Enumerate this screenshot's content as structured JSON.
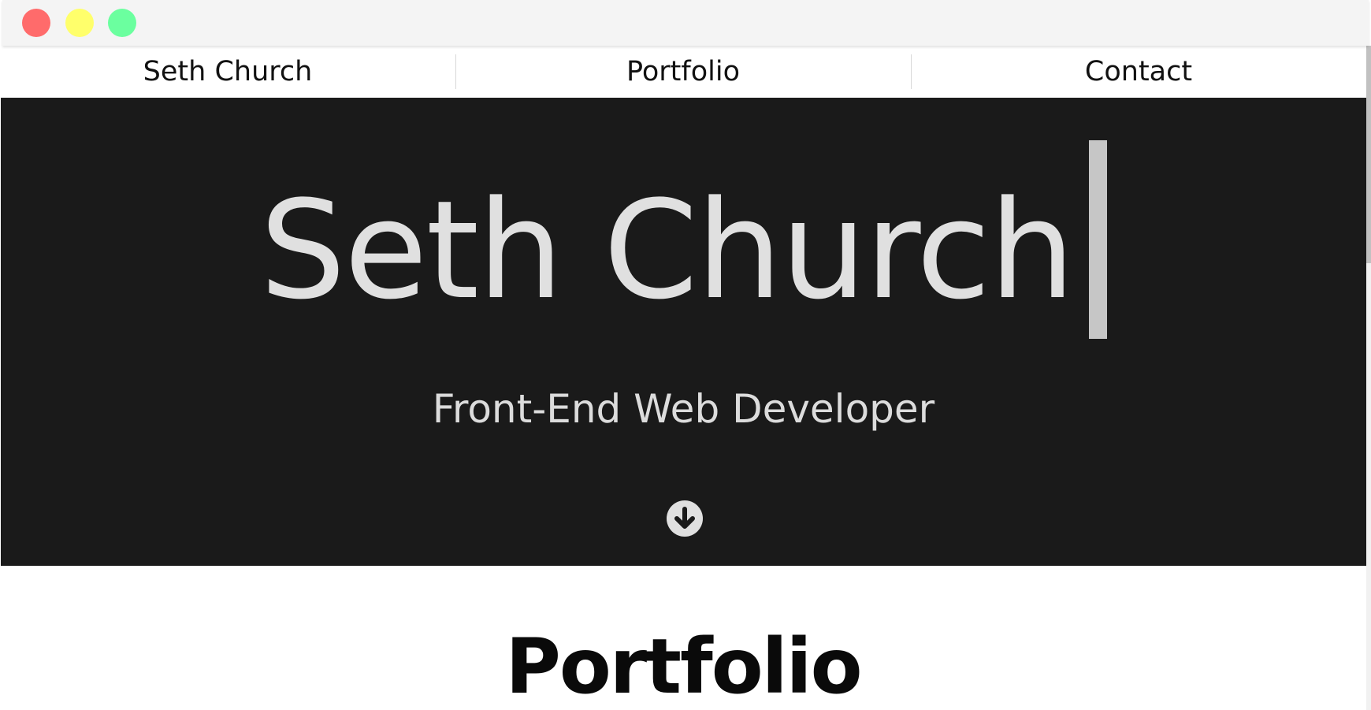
{
  "window": {
    "controls": [
      "close",
      "minimize",
      "maximize"
    ]
  },
  "nav": {
    "items": [
      {
        "label": "Seth Church"
      },
      {
        "label": "Portfolio"
      },
      {
        "label": "Contact"
      }
    ]
  },
  "hero": {
    "title": "Seth Church",
    "subtitle": "Front-End Web Developer",
    "scroll_icon": "arrow-down-circle-icon"
  },
  "portfolio": {
    "heading": "Portfolio"
  },
  "colors": {
    "hero_bg": "#1a1a1a",
    "hero_text": "#e0e0e0",
    "close": "#ff6b6b",
    "minimize": "#ffff6b",
    "maximize": "#6bff9f"
  }
}
